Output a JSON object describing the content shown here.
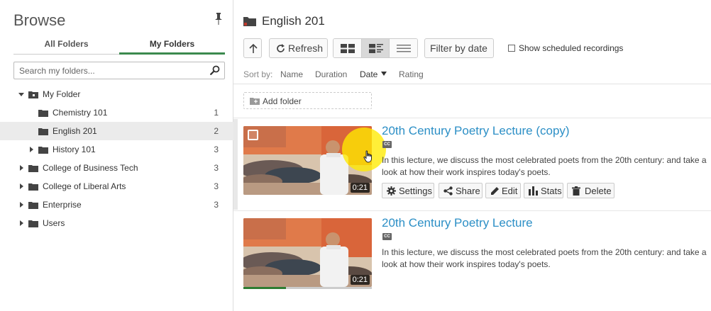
{
  "sidebar": {
    "title": "Browse",
    "tabs": [
      {
        "label": "All Folders",
        "active": false
      },
      {
        "label": "My Folders",
        "active": true
      }
    ],
    "search_placeholder": "Search my folders...",
    "tree": [
      {
        "label": "My Folder",
        "count": "",
        "expanded": true
      },
      {
        "label": "Chemistry 101",
        "count": "1"
      },
      {
        "label": "English 201",
        "count": "2",
        "selected": true
      },
      {
        "label": "History 101",
        "count": "3"
      },
      {
        "label": "College of Business Tech",
        "count": "3"
      },
      {
        "label": "College of Liberal Arts",
        "count": "3"
      },
      {
        "label": "Enterprise",
        "count": "3"
      },
      {
        "label": "Users",
        "count": ""
      }
    ]
  },
  "main": {
    "title": "English 201",
    "toolbar": {
      "refresh_label": "Refresh",
      "filter_label": "Filter by date",
      "scheduled_label": "Show scheduled recordings",
      "view_active": "detail"
    },
    "sort": {
      "prefix": "Sort by:",
      "options": [
        "Name",
        "Duration",
        "Date",
        "Rating"
      ],
      "active": "Date",
      "direction": "descending"
    },
    "add_folder_label": "Add folder",
    "sessions": [
      {
        "title": "20th Century Poetry Lecture (copy)",
        "cc": "CC",
        "description": "In this lecture, we discuss the most celebrated poets from the 20th century: and take a look at how their work inspires today's poets.",
        "duration": "0:21",
        "progress": 0,
        "actions": [
          "Settings",
          "Share",
          "Edit",
          "Stats",
          "Delete"
        ]
      },
      {
        "title": "20th Century Poetry Lecture",
        "cc": "CC",
        "description": "In this lecture, we discuss the most celebrated poets from the 20th century: and take a look at how their work inspires today's poets.",
        "duration": "0:21",
        "progress": 0.33
      }
    ]
  },
  "colors": {
    "accent_green": "#3c8a4e",
    "link_blue": "#2c8fc6",
    "progress_green": "#2e7d32",
    "folder_dark": "#444444",
    "highlight_yellow": "#ffeb00"
  }
}
